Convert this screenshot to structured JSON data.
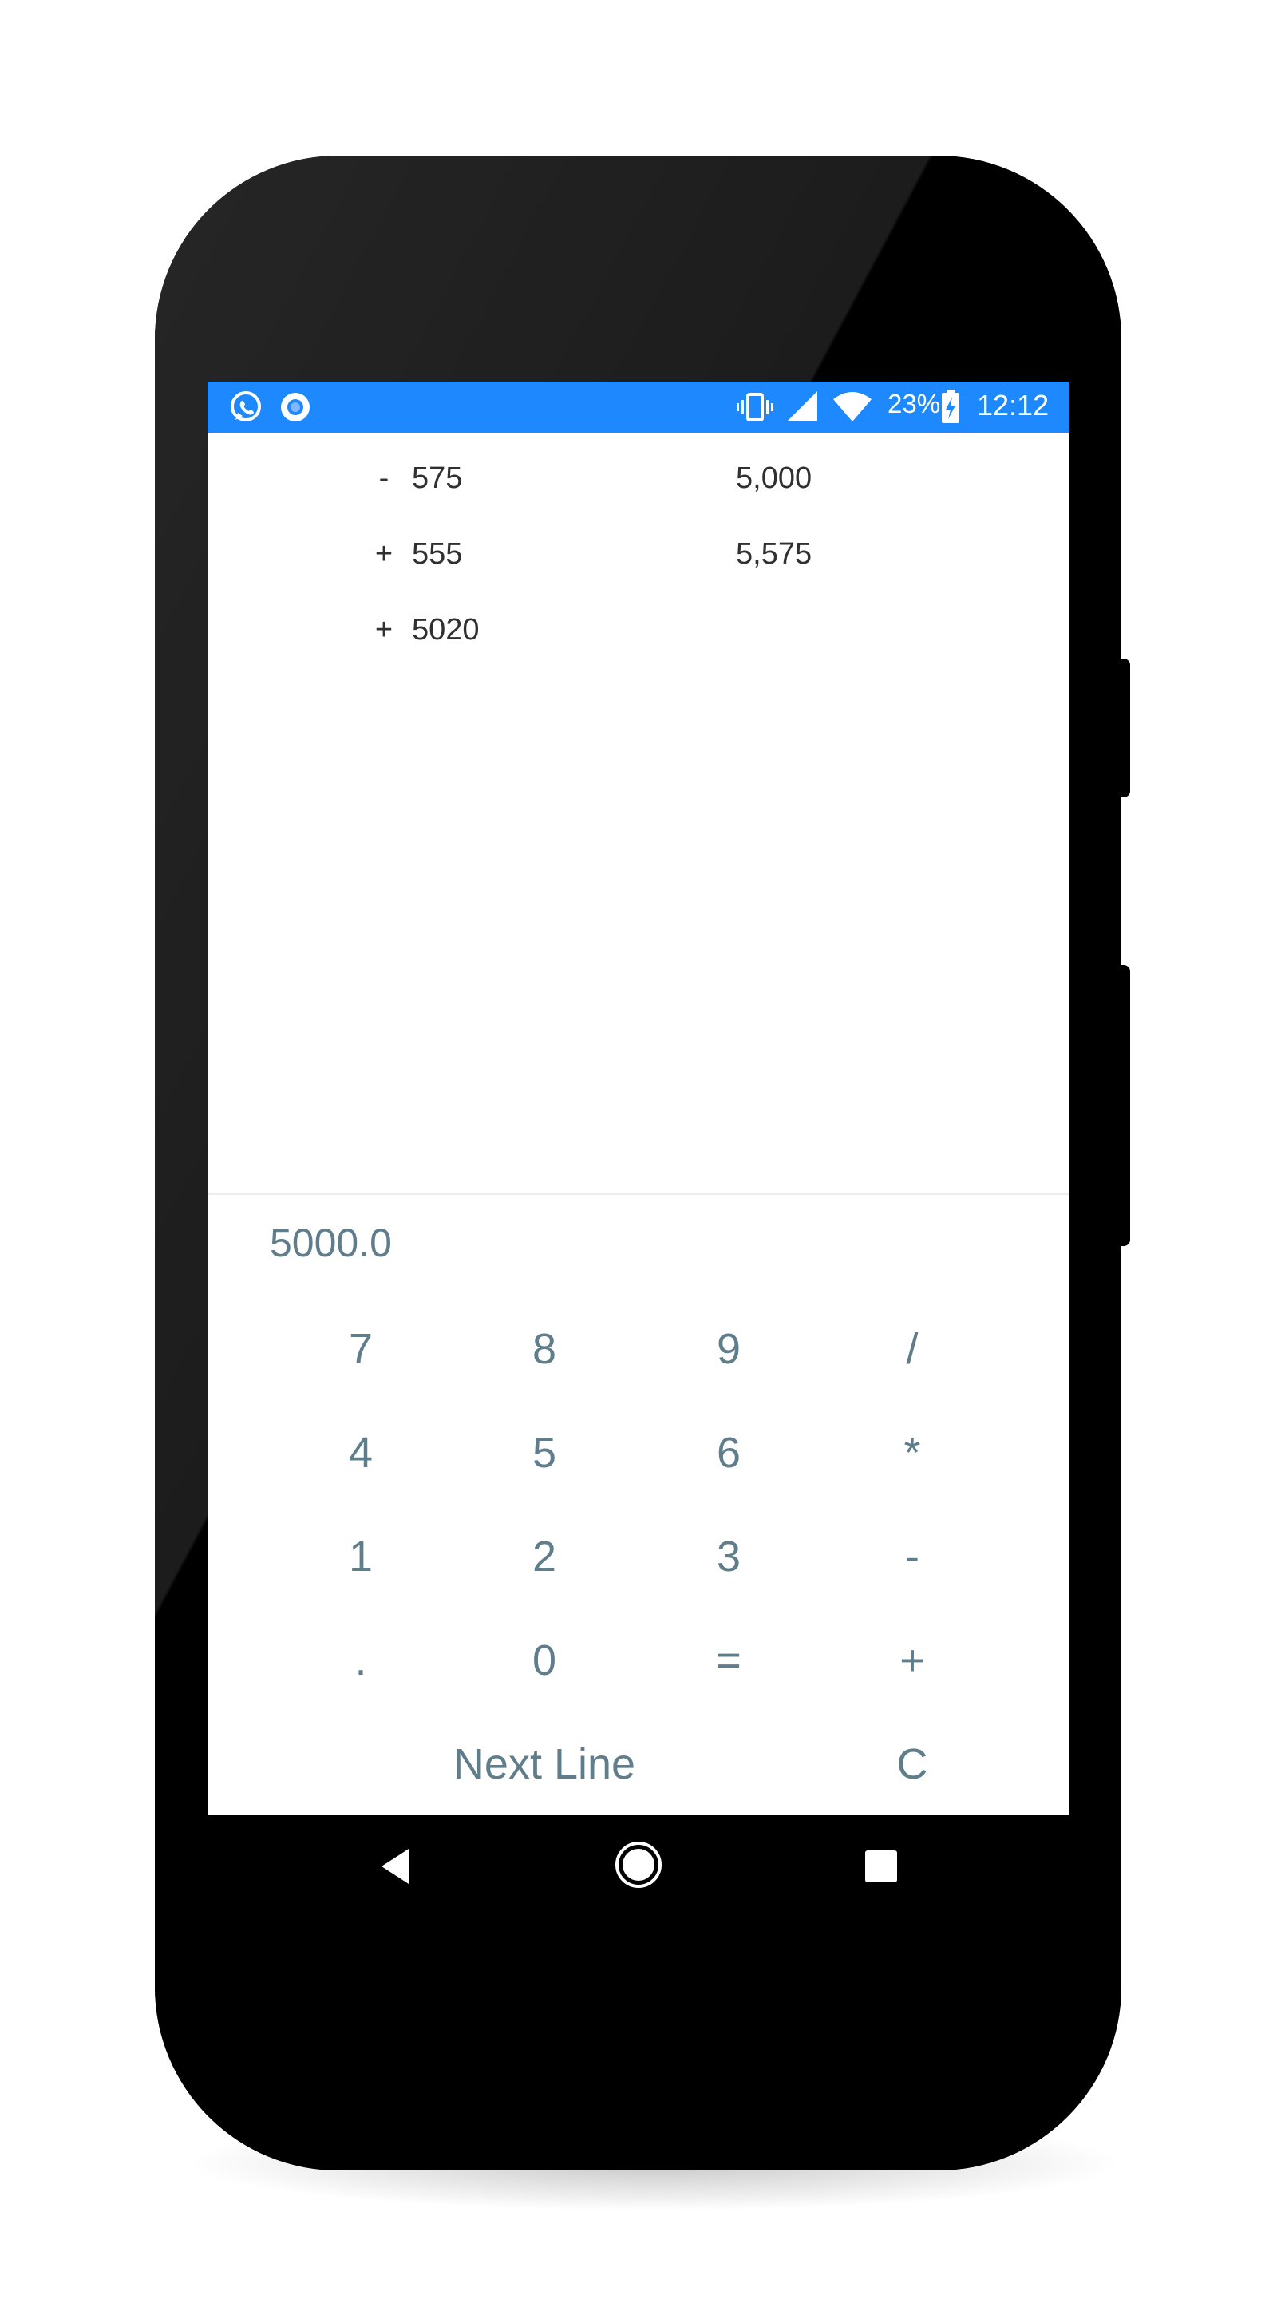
{
  "status_bar": {
    "left_icons": [
      "whatsapp-icon",
      "circle-notification-icon"
    ],
    "right_icons": [
      "vibrate-icon",
      "cell-signal-icon",
      "wifi-icon",
      "battery-charging-icon"
    ],
    "battery_percent": "23%",
    "time": "12:12",
    "background_color": "#1e88ff"
  },
  "history": [
    {
      "op": "-",
      "value": "575",
      "total": "5,000"
    },
    {
      "op": "+",
      "value": "555",
      "total": "5,575"
    },
    {
      "op": "+",
      "value": "5020",
      "total": ""
    }
  ],
  "display": {
    "value": "5000.0"
  },
  "keypad": {
    "rows": [
      [
        "7",
        "8",
        "9",
        "/"
      ],
      [
        "4",
        "5",
        "6",
        "*"
      ],
      [
        "1",
        "2",
        "3",
        "-"
      ],
      [
        ".",
        "0",
        "=",
        "+"
      ]
    ],
    "next_line": "Next Line",
    "clear": "C",
    "key_color": "#607d8b"
  },
  "nav_bar": {
    "buttons": [
      "back-icon",
      "home-icon",
      "recents-icon"
    ]
  }
}
